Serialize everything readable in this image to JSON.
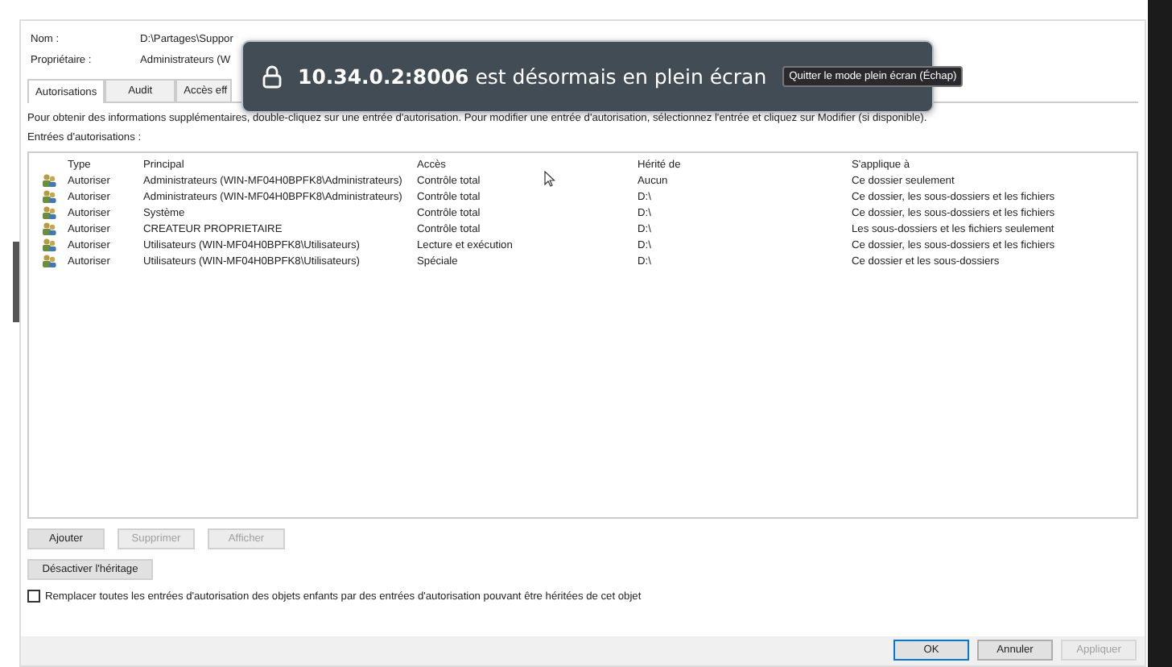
{
  "properties": [
    {
      "label": "Nom :",
      "value": "D:\\Partages\\Suppor"
    },
    {
      "label": "Propriétaire :",
      "value": "Administrateurs (W"
    }
  ],
  "tabs": [
    {
      "label": "Autorisations",
      "selected": true
    },
    {
      "label": "Audit",
      "selected": false
    },
    {
      "label": "Accès eff",
      "selected": false
    }
  ],
  "info": "Pour obtenir des informations supplémentaires, double-cliquez sur une entrée d'autorisation. Pour modifier une entrée d'autorisation, sélectionnez l'entrée et cliquez sur Modifier (si disponible).",
  "entries_label": "Entrées d'autorisations :",
  "table": {
    "columns": [
      "Type",
      "Principal",
      "Accès",
      "Hérité de",
      "S'applique à"
    ],
    "rows": [
      {
        "type": "Autoriser",
        "principal": "Administrateurs (WIN-MF04H0BPFK8\\Administrateurs)",
        "access": "Contrôle total",
        "inherited": "Aucun",
        "applies": "Ce dossier seulement"
      },
      {
        "type": "Autoriser",
        "principal": "Administrateurs (WIN-MF04H0BPFK8\\Administrateurs)",
        "access": "Contrôle total",
        "inherited": "D:\\",
        "applies": "Ce dossier, les sous-dossiers et les fichiers"
      },
      {
        "type": "Autoriser",
        "principal": "Système",
        "access": "Contrôle total",
        "inherited": "D:\\",
        "applies": "Ce dossier, les sous-dossiers et les fichiers"
      },
      {
        "type": "Autoriser",
        "principal": "CREATEUR PROPRIETAIRE",
        "access": "Contrôle total",
        "inherited": "D:\\",
        "applies": "Les sous-dossiers et les fichiers seulement"
      },
      {
        "type": "Autoriser",
        "principal": "Utilisateurs (WIN-MF04H0BPFK8\\Utilisateurs)",
        "access": "Lecture et exécution",
        "inherited": "D:\\",
        "applies": "Ce dossier, les sous-dossiers et les fichiers"
      },
      {
        "type": "Autoriser",
        "principal": "Utilisateurs (WIN-MF04H0BPFK8\\Utilisateurs)",
        "access": "Spéciale",
        "inherited": "D:\\",
        "applies": "Ce dossier et les sous-dossiers"
      }
    ]
  },
  "entry_buttons": [
    {
      "label": "Ajouter",
      "disabled": false
    },
    {
      "label": "Supprimer",
      "disabled": true
    },
    {
      "label": "Afficher",
      "disabled": true
    }
  ],
  "inheritance_button": "Désactiver l'héritage",
  "replace_checkbox": {
    "label": "Remplacer toutes les entrées d'autorisation des objets enfants par des entrées d'autorisation pouvant être héritées de cet objet",
    "checked": false
  },
  "dialog_buttons": [
    {
      "label": "OK",
      "disabled": false,
      "default": true
    },
    {
      "label": "Annuler",
      "disabled": false,
      "default": false
    },
    {
      "label": "Appliquer",
      "disabled": true,
      "default": false
    }
  ],
  "fullscreen_notice": {
    "host": "10.34.0.2:8006",
    "message": "est désormais en plein écran",
    "exit_button": "Quitter le mode plein écran (Échap)"
  }
}
